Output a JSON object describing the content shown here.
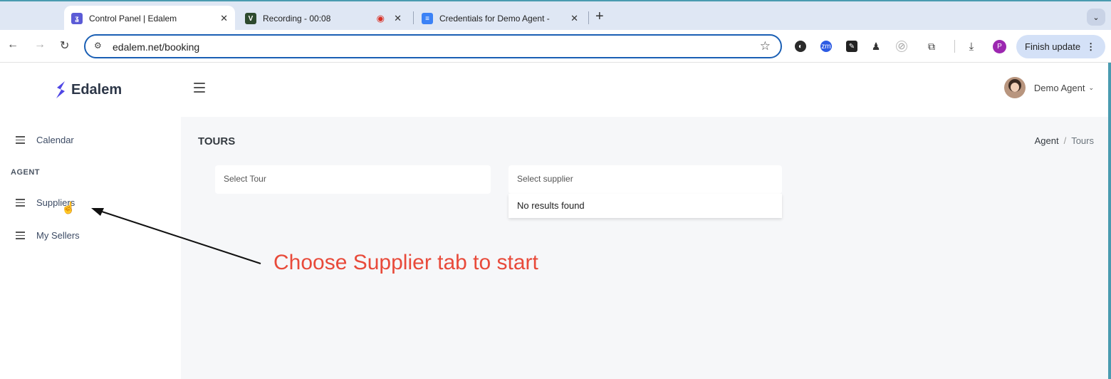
{
  "tabs": [
    {
      "title": "Control Panel | Edalem",
      "favicon": "edalem-icon",
      "active": true
    },
    {
      "title": "Recording - 00:08",
      "favicon": "recording-icon"
    },
    {
      "title": "Credentials for Demo Agent -",
      "favicon": "docs-icon"
    }
  ],
  "toolbar": {
    "url": "edalem.net/booking",
    "finish_update": "Finish update",
    "profile_initial": "P"
  },
  "app": {
    "brand": "Edalem",
    "user_name": "Demo Agent",
    "sidebar": {
      "calendar": "Calendar",
      "section_agent": "AGENT",
      "suppliers": "Suppliers",
      "my_sellers": "My Sellers"
    },
    "page_title": "TOURS",
    "breadcrumb": {
      "root": "Agent",
      "current": "Tours"
    },
    "select_tour_placeholder": "Select Tour",
    "select_supplier_placeholder": "Select supplier",
    "no_results": "No results found"
  },
  "annotation": {
    "text": "Choose Supplier tab to start",
    "color": "#e84a3a"
  },
  "colors": {
    "brand": "#4f46e5",
    "address_focus": "#1a5fb4",
    "frame": "#4a9bb0"
  }
}
